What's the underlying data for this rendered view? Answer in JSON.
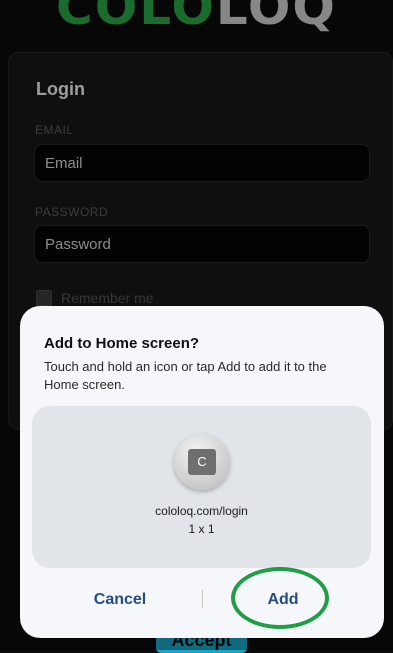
{
  "logo": {
    "text_green": "COLO",
    "text_grey": "LOQ"
  },
  "login": {
    "title": "Login",
    "email_label": "EMAIL",
    "email_placeholder": "Email",
    "email_value": "",
    "password_label": "PASSWORD",
    "password_placeholder": "Password",
    "password_value": "",
    "remember_label": "Remember me",
    "remember_checked": false
  },
  "cookie_banner": {
    "accept_label": "Accept"
  },
  "dialog": {
    "title": "Add to Home screen?",
    "message": "Touch and hold an icon or tap Add to add it to the Home screen.",
    "app_icon_letter": "C",
    "app_url": "cololoq.com/login",
    "app_size": "1 x 1",
    "cancel_label": "Cancel",
    "add_label": "Add"
  },
  "colors": {
    "brand_green": "#27a647",
    "dialog_button_text": "#254c86",
    "highlight_ring": "#1f9e46",
    "accept_button": "#19a5c6"
  },
  "icons": {
    "app_icon": "app-launcher-icon"
  }
}
